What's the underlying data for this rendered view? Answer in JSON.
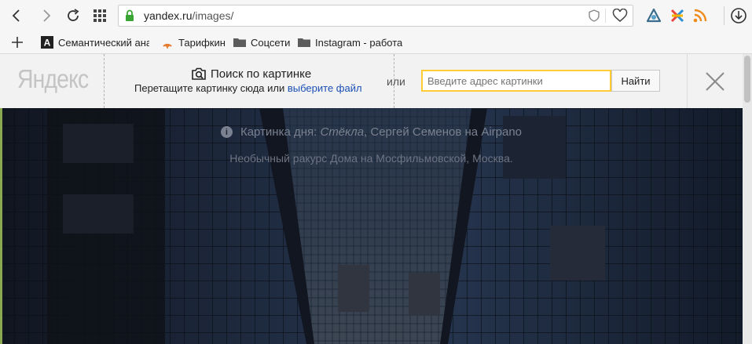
{
  "browser": {
    "url_host": "yandex.ru",
    "url_path": "/images/",
    "extensions": [
      "cloud-icon",
      "sync-icon",
      "rss-icon"
    ]
  },
  "bookmarks": {
    "items": [
      {
        "label": "Семантический анал",
        "icon": "a-letter-icon"
      },
      {
        "label": "Тарифкин",
        "icon": "tarifkin-icon"
      },
      {
        "label": "Соцсети",
        "icon": "folder-icon"
      },
      {
        "label": "Instagram - работа",
        "icon": "folder-icon"
      }
    ]
  },
  "header": {
    "logo": "Яндекс",
    "search_by_image": "Поиск по картинке",
    "drag_prefix": "Перетащите картинку сюда или ",
    "choose_file": "выберите файл",
    "or": "или",
    "url_placeholder": "Введите адрес картинки",
    "find_button": "Найти"
  },
  "hero": {
    "potd_prefix": "Картинка дня:",
    "potd_title": "Стёкла",
    "potd_author": ", Сергей Семенов на Airpano",
    "caption": "Необычный ракурс Дома на Мосфильмовской, Москва."
  },
  "colors": {
    "accent_input": "#ffcc33",
    "link": "#1a4fb5"
  }
}
